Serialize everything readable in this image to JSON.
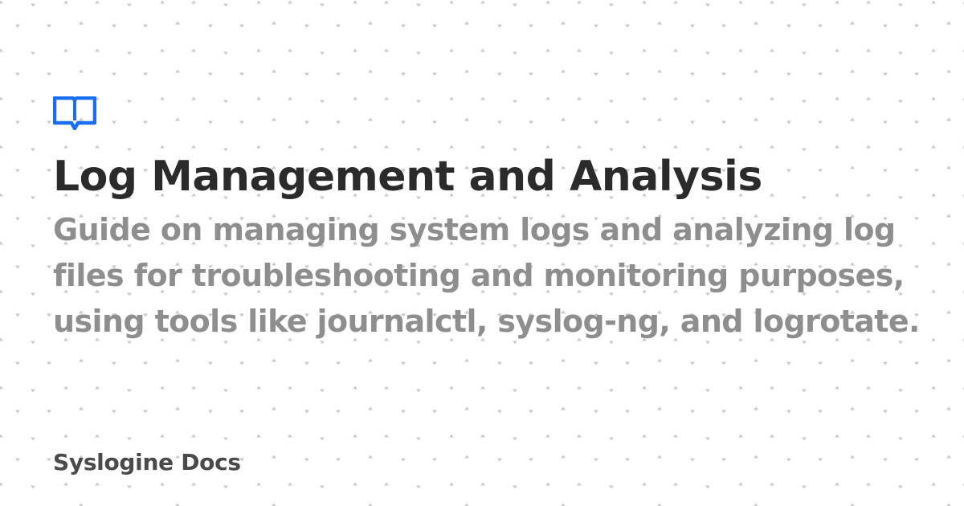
{
  "card": {
    "title": "Log Management and Analysis",
    "description": "Guide on managing system logs and analyzing log files for troubleshooting and monitoring purposes, using tools like journalctl, syslog-ng, and logrotate.",
    "site_name": "Syslogine Docs"
  },
  "colors": {
    "background": "#ffffff",
    "logo": "#1a6ef5",
    "title": "#2b2b2b",
    "description": "#8e8e8e",
    "site_name": "#4a4a4a",
    "pattern_dot": "#c9c9c9"
  },
  "icons": {
    "logo": "book-icon"
  }
}
